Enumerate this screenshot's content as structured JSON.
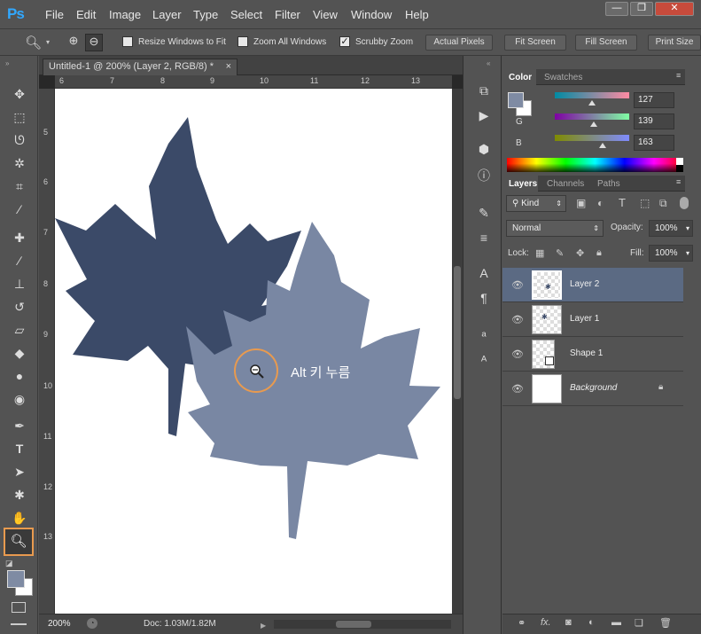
{
  "app": {
    "logo": "Ps"
  },
  "menu": [
    "File",
    "Edit",
    "Image",
    "Layer",
    "Type",
    "Select",
    "Filter",
    "View",
    "Window",
    "Help"
  ],
  "window_controls": {
    "minimize": "—",
    "restore": "❐",
    "close": "✕"
  },
  "options": {
    "resize_windows": "Resize Windows to Fit",
    "zoom_all": "Zoom All Windows",
    "scrubby": "Scrubby Zoom",
    "actual_pixels": "Actual Pixels",
    "fit_screen": "Fit Screen",
    "fill_screen": "Fill Screen",
    "print_size": "Print Size",
    "checked": {
      "resize_windows": false,
      "zoom_all": false,
      "scrubby": true
    }
  },
  "document": {
    "tab_title": "Untitled-1 @ 200% (Layer 2, RGB/8) *",
    "close": "×",
    "ruler_top": [
      "6",
      "7",
      "8",
      "9",
      "10",
      "11",
      "12",
      "13"
    ],
    "ruler_left": [
      "5",
      "6",
      "7",
      "8",
      "9",
      "10",
      "11",
      "12",
      "13"
    ],
    "annotation": "Alt 키 누름",
    "zoom": "200%",
    "doc_size": "Doc: 1.03M/1.82M"
  },
  "colors": {
    "dark_leaf": "#3b4a68",
    "light_leaf": "#7987a3",
    "highlight": "#e89a4f",
    "fg_swatch": "#7f8ba3"
  },
  "color_panel": {
    "tabs": [
      "Color",
      "Swatches"
    ],
    "channels": [
      {
        "name": "R",
        "value": "127"
      },
      {
        "name": "G",
        "value": "139"
      },
      {
        "name": "B",
        "value": "163"
      }
    ]
  },
  "layers_panel": {
    "tabs": [
      "Layers",
      "Channels",
      "Paths"
    ],
    "kind": "Kind",
    "blend": "Normal",
    "opacity_label": "Opacity:",
    "opacity": "100%",
    "lock_label": "Lock:",
    "fill_label": "Fill:",
    "fill": "100%",
    "layers": [
      {
        "name": "Layer 2",
        "selected": true
      },
      {
        "name": "Layer 1",
        "selected": false
      },
      {
        "name": "Shape 1",
        "selected": false
      },
      {
        "name": "Background",
        "selected": false
      }
    ]
  }
}
